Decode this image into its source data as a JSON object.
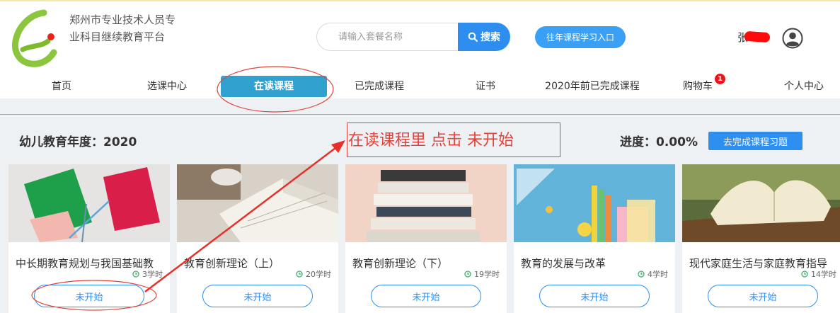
{
  "header": {
    "platform_name": "郑州市专业技术人员专业科目继续教育平台",
    "search": {
      "placeholder": "请输入套餐名称",
      "button_label": "搜索"
    },
    "history_button": "往年课程学习入口",
    "username": "张"
  },
  "nav": {
    "items": [
      {
        "label": "首页"
      },
      {
        "label": "选课中心"
      },
      {
        "label": "在读课程"
      },
      {
        "label": "已完成课程"
      },
      {
        "label": "证书"
      },
      {
        "label": "2020年前已完成课程"
      },
      {
        "label": "购物车"
      },
      {
        "label": "个人中心"
      }
    ],
    "active_index": 2,
    "cart_badge": "1"
  },
  "main": {
    "year_title": "幼儿教育年度：2020",
    "progress_label": "进度：",
    "progress_value": "0.00%",
    "exercise_button": "去完成课程习题"
  },
  "courses": [
    {
      "title": "中长期教育规划与我国基础教",
      "hours": "3学时",
      "button": "未开始"
    },
    {
      "title": "教育创新理论（上）",
      "hours": "20学时",
      "button": "未开始"
    },
    {
      "title": "教育创新理论（下）",
      "hours": "19学时",
      "button": "未开始"
    },
    {
      "title": "教育的发展与改革",
      "hours": "4学时",
      "button": "未开始"
    },
    {
      "title": "现代家庭生活与家庭教育指导",
      "hours": "14学时",
      "button": "未开始"
    }
  ],
  "annotation": {
    "text": "在读课程里 点击 未开始",
    "color": "#e0443a"
  },
  "colors": {
    "primary": "#2f8ff0",
    "nav_active": "#30a1cf",
    "hours_green": "#3bb16a",
    "badge_red": "#e8151b"
  }
}
